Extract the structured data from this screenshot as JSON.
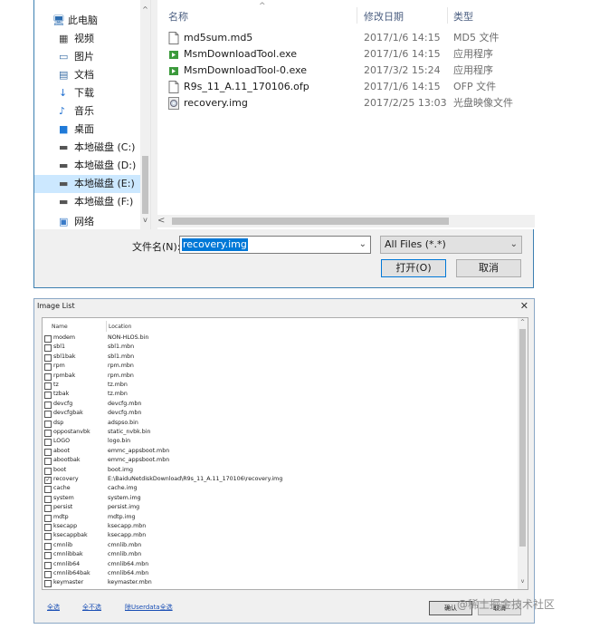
{
  "open_dialog": {
    "nav": {
      "items": [
        {
          "label": "此电脑",
          "icon": "computer-icon",
          "selected": false
        },
        {
          "label": "视频",
          "icon": "video-folder-icon",
          "selected": false
        },
        {
          "label": "图片",
          "icon": "pictures-folder-icon",
          "selected": false
        },
        {
          "label": "文档",
          "icon": "documents-folder-icon",
          "selected": false
        },
        {
          "label": "下载",
          "icon": "download-icon",
          "selected": false
        },
        {
          "label": "音乐",
          "icon": "music-icon",
          "selected": false
        },
        {
          "label": "桌面",
          "icon": "desktop-icon",
          "selected": false
        },
        {
          "label": "本地磁盘 (C:)",
          "icon": "drive-icon",
          "selected": false
        },
        {
          "label": "本地磁盘 (D:)",
          "icon": "drive-icon",
          "selected": false
        },
        {
          "label": "本地磁盘 (E:)",
          "icon": "drive-icon",
          "selected": true
        },
        {
          "label": "本地磁盘 (F:)",
          "icon": "drive-icon",
          "selected": false
        },
        {
          "label": "网络",
          "icon": "network-icon",
          "selected": false
        }
      ]
    },
    "columns": {
      "name": "名称",
      "date": "修改日期",
      "type": "类型"
    },
    "files": [
      {
        "name": "md5sum.md5",
        "date": "2017/1/6 14:15",
        "type": "MD5 文件",
        "icon": "file-icon"
      },
      {
        "name": "MsmDownloadTool.exe",
        "date": "2017/1/6 14:15",
        "type": "应用程序",
        "icon": "exe-icon"
      },
      {
        "name": "MsmDownloadTool-0.exe",
        "date": "2017/3/2 15:24",
        "type": "应用程序",
        "icon": "exe-icon"
      },
      {
        "name": "R9s_11_A.11_170106.ofp",
        "date": "2017/1/6 14:15",
        "type": "OFP 文件",
        "icon": "file-icon"
      },
      {
        "name": "recovery.img",
        "date": "2017/2/25 13:03",
        "type": "光盘映像文件",
        "icon": "disc-image-icon"
      }
    ],
    "filename_label": "文件名(N):",
    "filename_value": "recovery.img",
    "filetype_value": "All Files (*.*)",
    "open_label": "打开(O)",
    "cancel_label": "取消"
  },
  "image_list": {
    "title": "Image List",
    "columns": {
      "name": "Name",
      "location": "Location"
    },
    "rows": [
      {
        "name": "modem",
        "location": "NON-HLOS.bin",
        "checked": false
      },
      {
        "name": "sbl1",
        "location": "sbl1.mbn",
        "checked": false
      },
      {
        "name": "sbl1bak",
        "location": "sbl1.mbn",
        "checked": false
      },
      {
        "name": "rpm",
        "location": "rpm.mbn",
        "checked": false
      },
      {
        "name": "rpmbak",
        "location": "rpm.mbn",
        "checked": false
      },
      {
        "name": "tz",
        "location": "tz.mbn",
        "checked": false
      },
      {
        "name": "tzbak",
        "location": "tz.mbn",
        "checked": false
      },
      {
        "name": "devcfg",
        "location": "devcfg.mbn",
        "checked": false
      },
      {
        "name": "devcfgbak",
        "location": "devcfg.mbn",
        "checked": false
      },
      {
        "name": "dsp",
        "location": "adspso.bin",
        "checked": false
      },
      {
        "name": "oppostanvbk",
        "location": "static_nvbk.bin",
        "checked": false
      },
      {
        "name": "LOGO",
        "location": "logo.bin",
        "checked": false
      },
      {
        "name": "aboot",
        "location": "emmc_appsboot.mbn",
        "checked": false
      },
      {
        "name": "abootbak",
        "location": "emmc_appsboot.mbn",
        "checked": false
      },
      {
        "name": "boot",
        "location": "boot.img",
        "checked": false
      },
      {
        "name": "recovery",
        "location": "E:\\BaiduNetdiskDownload\\R9s_11_A.11_170106\\recovery.img",
        "checked": true
      },
      {
        "name": "cache",
        "location": "cache.img",
        "checked": false
      },
      {
        "name": "system",
        "location": "system.img",
        "checked": false
      },
      {
        "name": "persist",
        "location": "persist.img",
        "checked": false
      },
      {
        "name": "mdtp",
        "location": "mdtp.img",
        "checked": false
      },
      {
        "name": "ksecapp",
        "location": "ksecapp.mbn",
        "checked": false
      },
      {
        "name": "ksecappbak",
        "location": "ksecapp.mbn",
        "checked": false
      },
      {
        "name": "cmnlib",
        "location": "cmnlib.mbn",
        "checked": false
      },
      {
        "name": "cmnlibbak",
        "location": "cmnlib.mbn",
        "checked": false
      },
      {
        "name": "cmnlib64",
        "location": "cmnlib64.mbn",
        "checked": false
      },
      {
        "name": "cmnlib64bak",
        "location": "cmnlib64.mbn",
        "checked": false
      },
      {
        "name": "keymaster",
        "location": "keymaster.mbn",
        "checked": false
      }
    ],
    "select_all": "全选",
    "deselect_all": "全不选",
    "userdata_select": "除Userdata全选",
    "confirm_label": "确认",
    "cancel_label": "取消"
  },
  "watermark": "@稀土掘金技术社区",
  "colors": {
    "selection": "#0078d7",
    "nav_selected": "#cce8ff",
    "link": "#1a4fb5"
  }
}
